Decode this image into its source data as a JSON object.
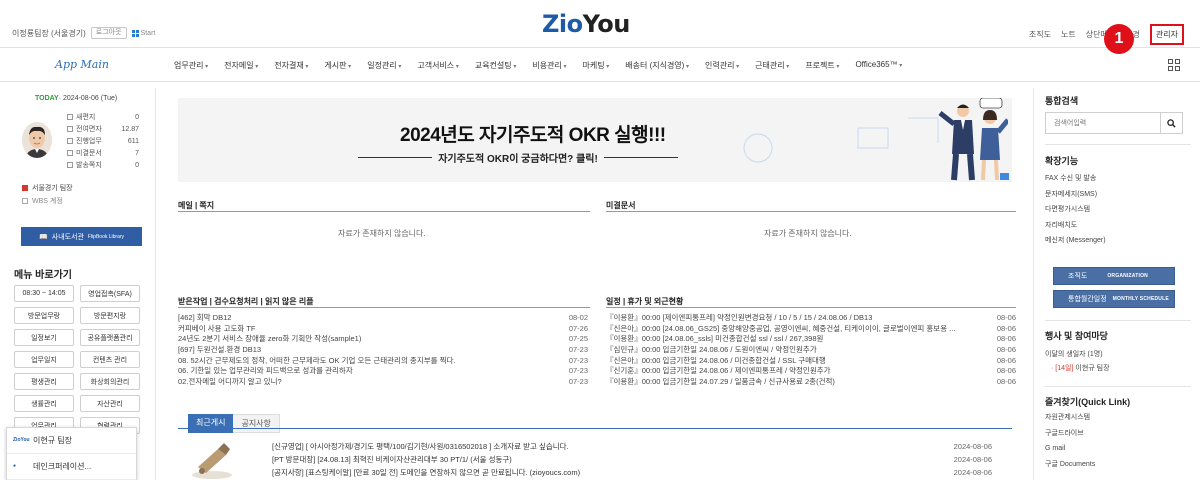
{
  "header": {
    "user_line": "이정룡팀장 (서울경기)",
    "logout_label": "로그아웃",
    "start_label": "Start",
    "logo_blue": "Zio",
    "logo_black": "You",
    "links": [
      "조직도",
      "노트",
      "상단메뉴",
      "환경",
      "관리자"
    ],
    "step_badge": "1"
  },
  "nav": {
    "app_main": "App Main",
    "items": [
      "업무관리",
      "전자메일",
      "전자결재",
      "게시판",
      "일정관리",
      "고객서비스",
      "교육컨설팅",
      "비용관리",
      "마케팅",
      "배송터 (지식경영)",
      "인력관리",
      "근태관리",
      "프로젝트",
      "Office365™"
    ]
  },
  "left": {
    "today_label": "TODAY",
    "today_date": "· 2024-08-06 (Tue)",
    "stats": [
      {
        "label": "새편지",
        "value": "0"
      },
      {
        "label": "전여면자",
        "value": "12.87"
      },
      {
        "label": "진행업무",
        "value": "611"
      },
      {
        "label": "미결문서",
        "value": "7"
      },
      {
        "label": "발송쪽지",
        "value": "0"
      }
    ],
    "team": "서울경기 팀장",
    "wbs": "WBS 계정",
    "flipbook": "사내도서관",
    "flipbook_en": "FlipBook Library",
    "menu_title": "메뉴 바로가기",
    "quick_links": [
      "08:30 ~ 14:05",
      "영업접촉(SFA)",
      "방문업무랑",
      "방문편지랑",
      "일정보기",
      "공유플랫폼관리",
      "업무일지",
      "컨텐츠 관리",
      "평생관리",
      "화상회의관리",
      "생률관리",
      "자산관리",
      "업무관리",
      "협력관리"
    ],
    "chat": [
      {
        "name": "이현규 팀장"
      },
      {
        "name": "데인크퍼레이션..."
      }
    ]
  },
  "banner": {
    "title": "2024년도 자기주도적 OKR 실행!!!",
    "subtitle": "자기주도적 OKR이 궁금하다면? 클릭!"
  },
  "panels": {
    "mail_title": "메일 | 쪽지",
    "mail_empty": "자료가 존재하지 않습니다.",
    "pending_title": "미결문서",
    "pending_empty": "자료가 존재하지 않습니다.",
    "work_title": "받은작업 | 검수요청처리 | 읽지 않은 리플",
    "work_items": [
      {
        "text": "[462] 회막 DB12",
        "date": "08-02"
      },
      {
        "text": "커피베이 사용 고도화 TF",
        "date": "07-26"
      },
      {
        "text": "24년도 2분기 서비스 장애율 zero화 기획안 작성(sample1)",
        "date": "07-25"
      },
      {
        "text": "[697] 두원건설.환경 DB13",
        "date": "07-23"
      },
      {
        "text": "08. 52시간 근무제도의 정착, 어떠한 근무제라도 OK 기업 오든 근태관리의 종지부를 찍다.",
        "date": "07-23"
      },
      {
        "text": "06. 기한일 있는 업무관리와 피드백으로 성과를 관리하자",
        "date": "07-23"
      },
      {
        "text": "02.전자메일 어디까지 알고 있니?",
        "date": "07-23"
      }
    ],
    "schedule_title": "일정 | 휴가 및 외근현황",
    "schedule_items": [
      {
        "text": "『이용환』00:00 [제이엔피통프레] 약정인원변경요청 / 10 / 5 / 15 / 24.08.06 / DB13",
        "date": "08-06"
      },
      {
        "text": "『신은아』00:00 [24.08.06_GS25] 중앙해양중공업, 공영이엔씨, 혜중건설, 티케이이이, 글로벌이엔피 홍보용 ...",
        "date": "08-06"
      },
      {
        "text": "『이용환』00:00 [24.08.06_ssls] 미건종합건설 ssl / ssl / 267,398원",
        "date": "08-06"
      },
      {
        "text": "『심민규』00:00 입금기한일 24.08.06 / 도원이엔씨 / 약정인원추가",
        "date": "08-06"
      },
      {
        "text": "『신은아』00:00 입금기한일 24.08.06 / 미건종합건설 / SSL 구매대행",
        "date": "08-06"
      },
      {
        "text": "『신기훈』00:00 입금기한일 24.08.06 / 제이엔피통프레 / 약정인원추가",
        "date": "08-06"
      },
      {
        "text": "『이용환』00:00 입금기한일 24.07.29 / 일품금속 / 신규사용료 2종(건적)",
        "date": "08-06"
      }
    ]
  },
  "tabs": [
    "최근게시",
    "공지사항"
  ],
  "news": [
    {
      "text": "[신규영업] [ 아시아정가제/경기도 평택/100/김기현/사원/0316502018 ] 소개자료 받고 싶습니다.",
      "date": "2024-08-06"
    },
    {
      "text": "[PT 방문대장] [24.08.13] 최혁진 비케이자산관리대부 30 PT/1/ (서울 성동구)",
      "date": "2024-08-06"
    },
    {
      "text": "[공지사항] [표스팅케이알] [만료 30일 전] 도메인을 연장하지 않으면 곧 만료됩니다. (zioyoucs.com)",
      "date": "2024-08-06"
    }
  ],
  "right": {
    "search_title": "통합검색",
    "search_placeholder": "검색어입력",
    "ext_title": "확장기능",
    "ext_items": [
      "FAX 수신 및 발송",
      "문자메세지(SMS)",
      "다면평가시스템",
      "자리배치도",
      "메신저 (Messenger)"
    ],
    "org_btn": "조직도",
    "org_btn_en": "ORGANIZATION",
    "sched_btn": "통합월간일정",
    "sched_btn_en": "MONTHLY SCHEDULE",
    "events_title": "행사 및 참여마당",
    "birthday": "이달의 생일자 (1명)",
    "birthday_person_date": "[14일]",
    "birthday_person": "이현규 팀장",
    "quick_title": "즐겨찾기(Quick Link)",
    "quick_items": [
      "자원관제시스템",
      "구글드라이브",
      "G mail",
      "구글 Documents"
    ]
  }
}
